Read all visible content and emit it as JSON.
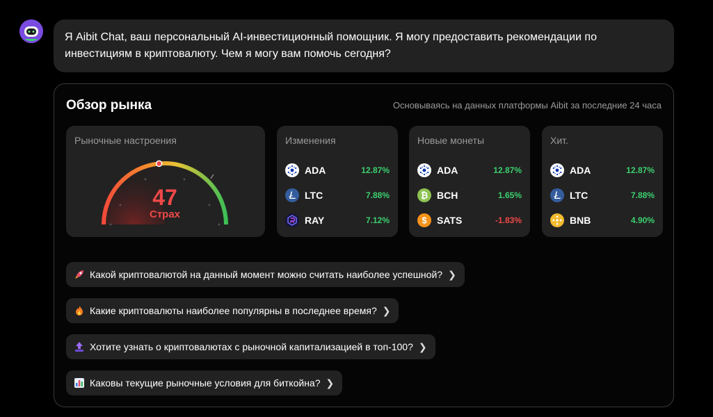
{
  "assistant": {
    "avatar_icon": "robot-avatar-icon",
    "message": "Я Aibit Chat, ваш персональный AI-инвестиционный помощник. Я могу предоставить рекомендации по инвестициям в криптовалюту. Чем я могу вам помочь сегодня?"
  },
  "market": {
    "title": "Обзор рынка",
    "subtitle": "Основываясь на данных платформы Aibit за последние 24 часа",
    "sentiment": {
      "title": "Рыночные настроения",
      "value": "47",
      "label": "Страх",
      "level_percent": 47
    },
    "cards": [
      {
        "title": "Изменения",
        "items": [
          {
            "symbol": "ADA",
            "change": "12.87%",
            "direction": "up",
            "icon": "ada-icon",
            "color": "#ffffff"
          },
          {
            "symbol": "LTC",
            "change": "7.88%",
            "direction": "up",
            "icon": "ltc-icon",
            "color": "#345d9d"
          },
          {
            "symbol": "RAY",
            "change": "7.12%",
            "direction": "up",
            "icon": "ray-icon",
            "color": "#2b2f8f"
          }
        ]
      },
      {
        "title": "Новые монеты",
        "items": [
          {
            "symbol": "ADA",
            "change": "12.87%",
            "direction": "up",
            "icon": "ada-icon",
            "color": "#ffffff"
          },
          {
            "symbol": "BCH",
            "change": "1.65%",
            "direction": "up",
            "icon": "bch-icon",
            "color": "#8dc351"
          },
          {
            "symbol": "SATS",
            "change": "-1.83%",
            "direction": "down",
            "icon": "sats-icon",
            "color": "#f7931a"
          }
        ]
      },
      {
        "title": "Хит.",
        "items": [
          {
            "symbol": "ADA",
            "change": "12.87%",
            "direction": "up",
            "icon": "ada-icon",
            "color": "#ffffff"
          },
          {
            "symbol": "LTC",
            "change": "7.88%",
            "direction": "up",
            "icon": "ltc-icon",
            "color": "#345d9d"
          },
          {
            "symbol": "BNB",
            "change": "4.90%",
            "direction": "up",
            "icon": "bnb-icon",
            "color": "#f3ba2f"
          }
        ]
      }
    ]
  },
  "suggestions": [
    {
      "icon": "rocket-icon",
      "text": "Какой криптовалютой на данный момент можно считать наиболее успешной?"
    },
    {
      "icon": "fire-icon",
      "text": "Какие криптовалюты наиболее популярны в последнее время?"
    },
    {
      "icon": "top-arrow-icon",
      "text": "Хотите узнать о криптовалютах с рыночной капитализацией в топ-100?"
    },
    {
      "icon": "bar-chart-icon",
      "text": "Каковы текущие рыночные условия для биткойна?"
    }
  ],
  "colors": {
    "up": "#3ccf6e",
    "down": "#f04848",
    "fear": "#f04848",
    "card_bg": "#222222"
  }
}
